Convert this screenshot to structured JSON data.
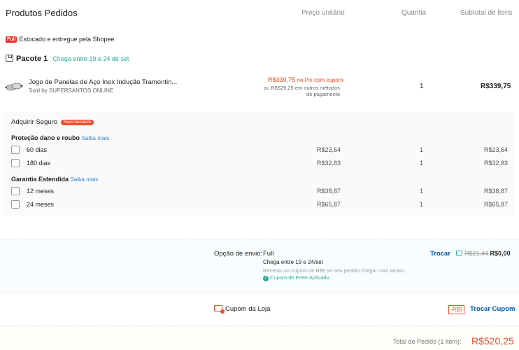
{
  "header": {
    "title": "Produtos Pedidos",
    "col_price": "Preço unitário",
    "col_qty": "Quantia",
    "col_subtotal": "Subtotal de itens"
  },
  "seller": {
    "badge": "Full",
    "label": "Estocado e entregue pela Shopee"
  },
  "package": {
    "title": "Pacote 1",
    "eta": "Chega entre 19 e 24 de set"
  },
  "product": {
    "name": "Jogo de Panelas de Aço Inox Indução Tramontin...",
    "sold_by": "Sold by SUPERSANTOS ONLINE",
    "pix_price": "R$339,75",
    "pix_note": "no Pix com cupom",
    "other_line1": "ou R$525,25 em outros métodos",
    "other_line2": "de pagamento",
    "qty": "1",
    "subtotal": "R$339,75"
  },
  "insurance": {
    "title": "Adquirir Seguro",
    "badge": "Recomendado",
    "groups": [
      {
        "title": "Proteção dano e roubo",
        "link": "Saiba mais",
        "options": [
          {
            "label": "60 dias",
            "price": "R$23,64",
            "qty": "1",
            "subtotal": "R$23,64"
          },
          {
            "label": "180 dias",
            "price": "R$32,83",
            "qty": "1",
            "subtotal": "R$32,83"
          }
        ]
      },
      {
        "title": "Garantia Estendida",
        "link": "Saiba mais",
        "options": [
          {
            "label": "12 meses",
            "price": "R$38,87",
            "qty": "1",
            "subtotal": "R$38,87"
          },
          {
            "label": "24 meses",
            "price": "R$65,87",
            "qty": "1",
            "subtotal": "R$65,87"
          }
        ]
      }
    ]
  },
  "shipping": {
    "label": "Opção de envio:",
    "method": "Full",
    "eta": "Chega entre 19 e 24/set",
    "note": "Receba um cupom de R$5 se seu pedido chegar com atraso.",
    "applied": "Cupom de Frete Aplicado",
    "change": "Trocar",
    "old_price": "R$21,44",
    "new_price": "R$0,00"
  },
  "coupon": {
    "label": "Cupom da Loja",
    "tag": "-R$5",
    "change": "Trocar Cupom"
  },
  "total": {
    "label": "Total do Pedido (1 item):",
    "value": "R$520,25"
  },
  "colors": {
    "accent": "#ee4d2d",
    "teal": "#26aa99",
    "link": "#0055aa"
  }
}
